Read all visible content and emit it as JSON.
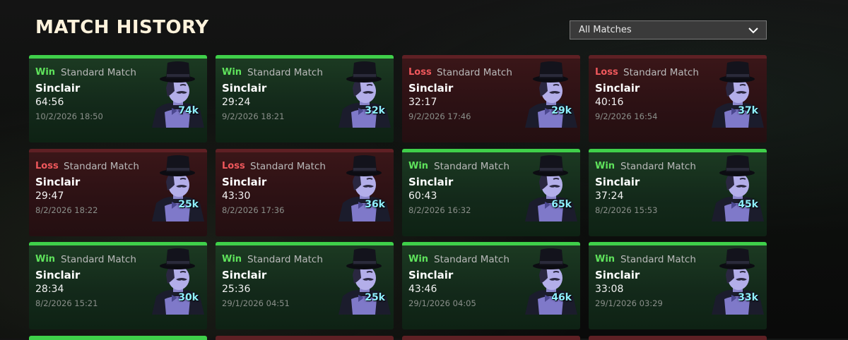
{
  "header": {
    "title": "MATCH HISTORY"
  },
  "filter": {
    "selected": "All Matches"
  },
  "colors": {
    "win": "#3fcf4a",
    "loss": "#5e2024",
    "score": "#8ff0ff"
  },
  "matches": [
    {
      "result": "Win",
      "type": "Standard Match",
      "player": "Sinclair",
      "duration": "64:56",
      "date": "10/2/2026 18:50",
      "score": "74k"
    },
    {
      "result": "Win",
      "type": "Standard Match",
      "player": "Sinclair",
      "duration": "29:24",
      "date": "9/2/2026 18:21",
      "score": "32k"
    },
    {
      "result": "Loss",
      "type": "Standard Match",
      "player": "Sinclair",
      "duration": "32:17",
      "date": "9/2/2026 17:46",
      "score": "29k"
    },
    {
      "result": "Loss",
      "type": "Standard Match",
      "player": "Sinclair",
      "duration": "40:16",
      "date": "9/2/2026 16:54",
      "score": "37k"
    },
    {
      "result": "Loss",
      "type": "Standard Match",
      "player": "Sinclair",
      "duration": "29:47",
      "date": "8/2/2026 18:22",
      "score": "25k"
    },
    {
      "result": "Loss",
      "type": "Standard Match",
      "player": "Sinclair",
      "duration": "43:30",
      "date": "8/2/2026 17:36",
      "score": "36k"
    },
    {
      "result": "Win",
      "type": "Standard Match",
      "player": "Sinclair",
      "duration": "60:43",
      "date": "8/2/2026 16:32",
      "score": "65k"
    },
    {
      "result": "Win",
      "type": "Standard Match",
      "player": "Sinclair",
      "duration": "37:24",
      "date": "8/2/2026 15:53",
      "score": "45k"
    },
    {
      "result": "Win",
      "type": "Standard Match",
      "player": "Sinclair",
      "duration": "28:34",
      "date": "8/2/2026 15:21",
      "score": "30k"
    },
    {
      "result": "Win",
      "type": "Standard Match",
      "player": "Sinclair",
      "duration": "25:36",
      "date": "29/1/2026 04:51",
      "score": "25k"
    },
    {
      "result": "Win",
      "type": "Standard Match",
      "player": "Sinclair",
      "duration": "43:46",
      "date": "29/1/2026 04:05",
      "score": "46k"
    },
    {
      "result": "Win",
      "type": "Standard Match",
      "player": "Sinclair",
      "duration": "33:08",
      "date": "29/1/2026 03:29",
      "score": "33k"
    }
  ],
  "next_row_results": [
    "Win",
    "Loss",
    "Loss",
    "Loss"
  ]
}
